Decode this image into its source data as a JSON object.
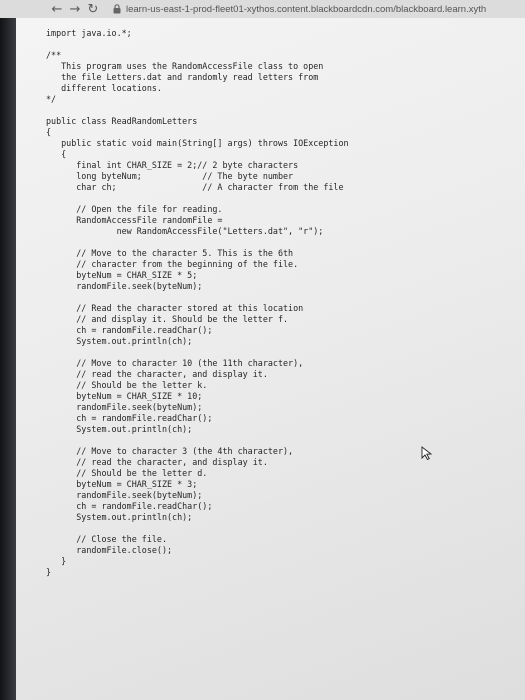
{
  "browser": {
    "back_icon": "arrow-left-icon",
    "forward_icon": "arrow-right-icon",
    "reload_icon": "reload-icon",
    "lock_icon": "lock-icon",
    "url": "learn-us-east-1-prod-fleet01-xythos.content.blackboardcdn.com/blackboard.learn.xyth"
  },
  "code": {
    "lines": [
      "import java.io.*;",
      "",
      "/**",
      "   This program uses the RandomAccessFile class to open",
      "   the file Letters.dat and randomly read letters from",
      "   different locations.",
      "*/",
      "",
      "public class ReadRandomLetters",
      "{",
      "   public static void main(String[] args) throws IOException",
      "   {",
      "      final int CHAR_SIZE = 2;// 2 byte characters",
      "      long byteNum;            // The byte number",
      "      char ch;                 // A character from the file",
      "",
      "      // Open the file for reading.",
      "      RandomAccessFile randomFile =",
      "              new RandomAccessFile(\"Letters.dat\", \"r\");",
      "",
      "      // Move to the character 5. This is the 6th",
      "      // character from the beginning of the file.",
      "      byteNum = CHAR_SIZE * 5;",
      "      randomFile.seek(byteNum);",
      "",
      "      // Read the character stored at this location",
      "      // and display it. Should be the letter f.",
      "      ch = randomFile.readChar();",
      "      System.out.println(ch);",
      "",
      "      // Move to character 10 (the 11th character),",
      "      // read the character, and display it.",
      "      // Should be the letter k.",
      "      byteNum = CHAR_SIZE * 10;",
      "      randomFile.seek(byteNum);",
      "      ch = randomFile.readChar();",
      "      System.out.println(ch);",
      "",
      "      // Move to character 3 (the 4th character),",
      "      // read the character, and display it.",
      "      // Should be the letter d.",
      "      byteNum = CHAR_SIZE * 3;",
      "      randomFile.seek(byteNum);",
      "      ch = randomFile.readChar();",
      "      System.out.println(ch);",
      "",
      "      // Close the file.",
      "      randomFile.close();",
      "   }",
      "}"
    ]
  },
  "cursor_icon": "mouse-pointer-icon"
}
